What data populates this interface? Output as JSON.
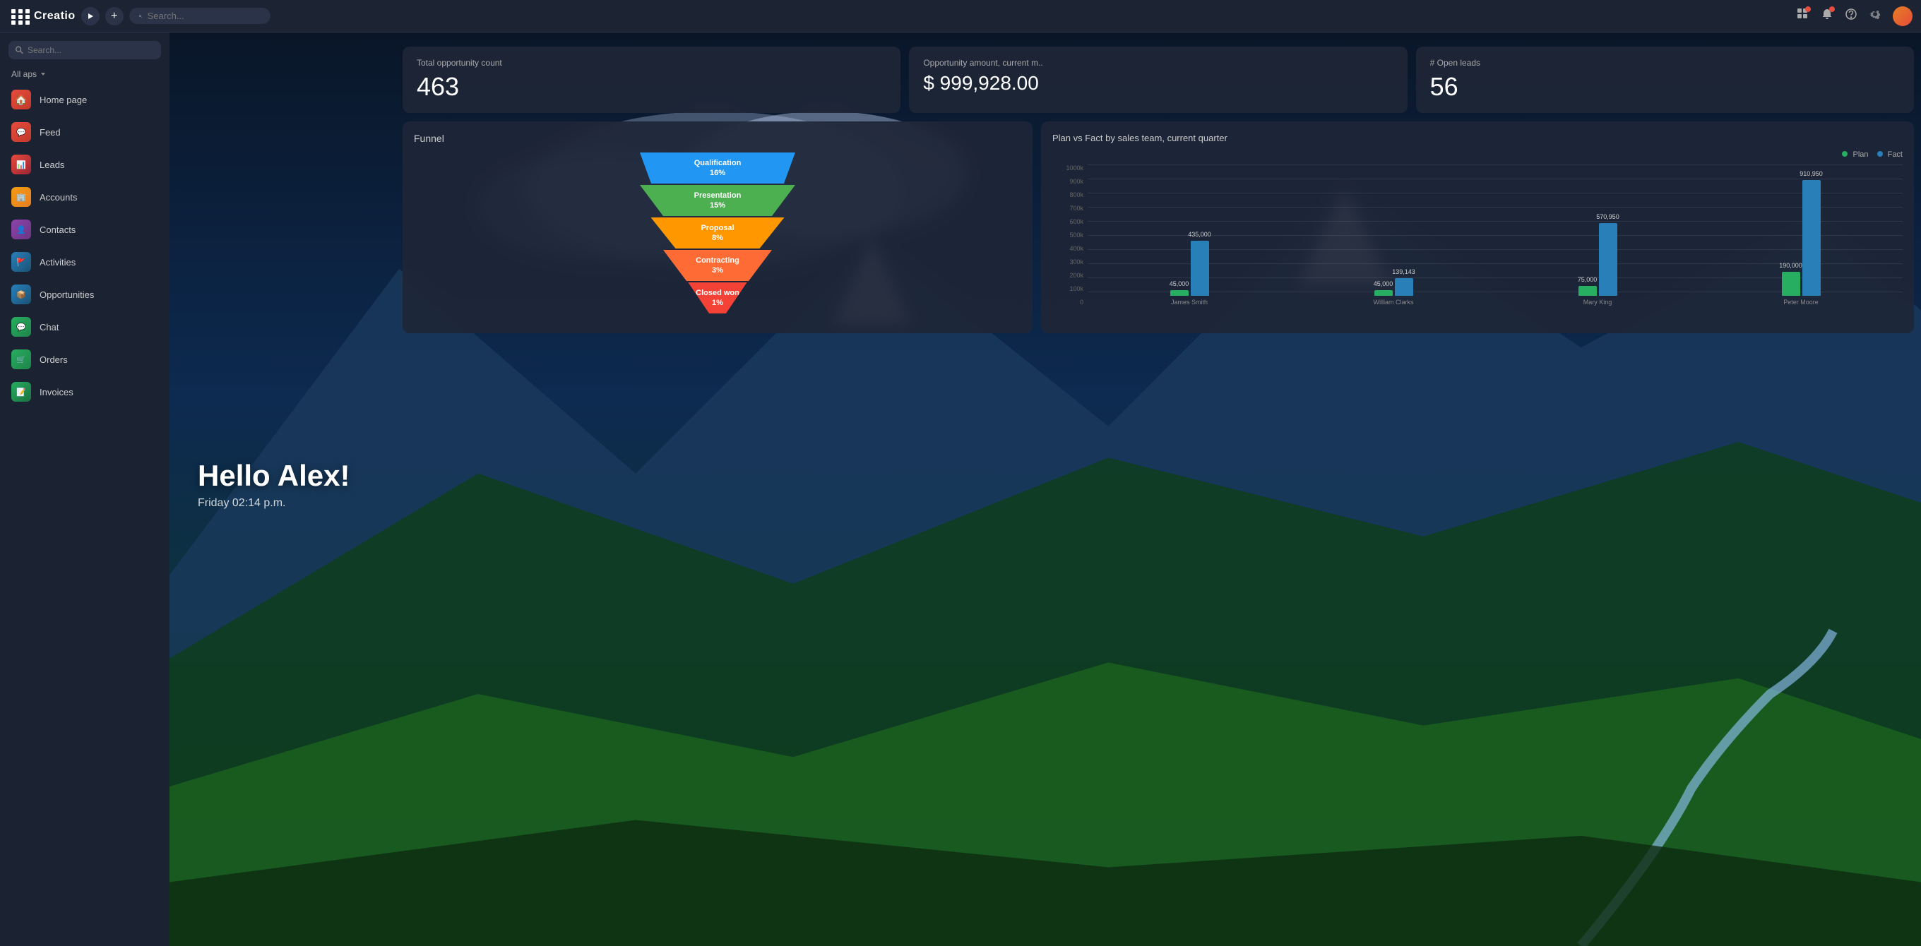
{
  "topbar": {
    "logo": "Creatio",
    "search_placeholder": "Search...",
    "icons": [
      "apps",
      "notification",
      "help",
      "settings",
      "avatar"
    ]
  },
  "sidebar": {
    "search_placeholder": "Search...",
    "all_apps_label": "All aps",
    "nav_items": [
      {
        "id": "home",
        "label": "Home page",
        "icon": "🏠"
      },
      {
        "id": "feed",
        "label": "Feed",
        "icon": "💬"
      },
      {
        "id": "leads",
        "label": "Leads",
        "icon": "📊"
      },
      {
        "id": "accounts",
        "label": "Accounts",
        "icon": "🏢"
      },
      {
        "id": "contacts",
        "label": "Contacts",
        "icon": "👤"
      },
      {
        "id": "activities",
        "label": "Activities",
        "icon": "📋"
      },
      {
        "id": "opportunities",
        "label": "Opportunities",
        "icon": "📦"
      },
      {
        "id": "chat",
        "label": "Chat",
        "icon": "💬"
      },
      {
        "id": "orders",
        "label": "Orders",
        "icon": "🛒"
      },
      {
        "id": "invoices",
        "label": "Invoices",
        "icon": "📝"
      }
    ]
  },
  "hero": {
    "greeting": "Hello Alex!",
    "datetime": "Friday 02:14 p.m."
  },
  "widgets": {
    "opportunity_count": {
      "label": "Total opportunity count",
      "value": "463"
    },
    "opportunity_amount": {
      "label": "Opportunity amount, current m..",
      "value": "$ 999,928.00"
    },
    "open_leads": {
      "label": "# Open leads",
      "value": "56"
    },
    "funnel": {
      "title": "Funnel",
      "segments": [
        {
          "label": "Qualification",
          "percent": "16%",
          "color": "#2196F3",
          "width": 100
        },
        {
          "label": "Presentation",
          "percent": "15%",
          "color": "#4CAF50",
          "width": 86
        },
        {
          "label": "Proposal",
          "percent": "8%",
          "color": "#FF9800",
          "width": 70
        },
        {
          "label": "Contracting",
          "percent": "3%",
          "color": "#FF6B35",
          "width": 54
        },
        {
          "label": "Closed won",
          "percent": "1%",
          "color": "#F44336",
          "width": 40
        }
      ]
    },
    "chart": {
      "title": "Plan vs Fact by sales team, current quarter",
      "legend": [
        {
          "label": "Plan",
          "color": "#27ae60"
        },
        {
          "label": "Fact",
          "color": "#2980b9"
        }
      ],
      "y_labels": [
        "1000k",
        "900k",
        "800k",
        "700k",
        "600k",
        "500k",
        "400k",
        "300k",
        "200k",
        "100k",
        "0"
      ],
      "groups": [
        {
          "name": "James Smith",
          "plan": 45000,
          "fact": 435000,
          "plan_label": "45,000",
          "fact_label": "435,000",
          "plan_height": 10,
          "fact_height": 43
        },
        {
          "name": "William Clarks",
          "plan": 45000,
          "fact": 139143,
          "plan_label": "45,000",
          "fact_label": "139,143",
          "plan_height": 10,
          "fact_height": 14
        },
        {
          "name": "Mary King",
          "plan": 75000,
          "fact": 570950,
          "plan_label": "75,000",
          "fact_label": "570,950",
          "plan_height": 8,
          "fact_height": 57
        },
        {
          "name": "Peter Moore",
          "plan": 190000,
          "fact": 910950,
          "plan_label": "190,000",
          "fact_label": "910,950",
          "plan_height": 19,
          "fact_height": 91
        }
      ]
    }
  }
}
